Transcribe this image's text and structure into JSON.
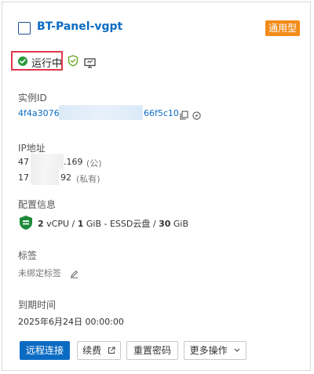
{
  "instance": {
    "name": "BT-Panel-vgpt",
    "type_badge": "通用型",
    "status": "运行中"
  },
  "instance_id": {
    "label": "实例ID",
    "prefix": "4f4a3076",
    "suffix": "66f5c10"
  },
  "ip": {
    "label": "IP地址",
    "public_prefix": "47",
    "public_suffix": ".169",
    "public_tag": "(公)",
    "private_prefix": "17",
    "private_suffix": "92",
    "private_tag": "(私有)"
  },
  "config": {
    "label": "配置信息",
    "vcpu_count": "2",
    "vcpu_unit": "vCPU /",
    "memory": "1",
    "memory_unit": "GiB - ESSD云盘 /",
    "disk": "30",
    "disk_unit": "GiB"
  },
  "tags": {
    "label": "标签",
    "value": "未绑定标签"
  },
  "expiry": {
    "label": "到期时间",
    "value": "2025年6月24日 00:00:00"
  },
  "actions": {
    "remote_connect": "远程连接",
    "renew": "续费",
    "reset_password": "重置密码",
    "more": "更多操作"
  },
  "colors": {
    "accent": "#0b6bc3",
    "badge": "#f28c1a",
    "running": "#2c9a3a",
    "highlight_border": "#e0394b"
  }
}
